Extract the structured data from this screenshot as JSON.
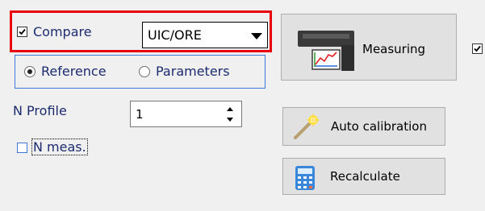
{
  "compare": {
    "label": "Compare",
    "checked": true
  },
  "standard_select": {
    "value": "UIC/ORE"
  },
  "mode_radio": {
    "options": [
      {
        "label": "Reference",
        "selected": true
      },
      {
        "label": "Parameters",
        "selected": false
      }
    ]
  },
  "n_profile": {
    "label": "N Profile",
    "value": "1"
  },
  "n_meas": {
    "label": "N meas.",
    "checked": false
  },
  "buttons": {
    "measuring": {
      "label": "Measuring",
      "icon": "measuring-device-icon"
    },
    "auto_calibration": {
      "label": "Auto calibration",
      "icon": "magic-wand-icon"
    },
    "recalculate": {
      "label": "Recalculate",
      "icon": "calculator-icon"
    }
  },
  "right_checkbox": {
    "checked": true
  },
  "colors": {
    "highlight": "#e8000d",
    "group_border": "#3c78d8",
    "label_text": "#1c2b6e"
  }
}
